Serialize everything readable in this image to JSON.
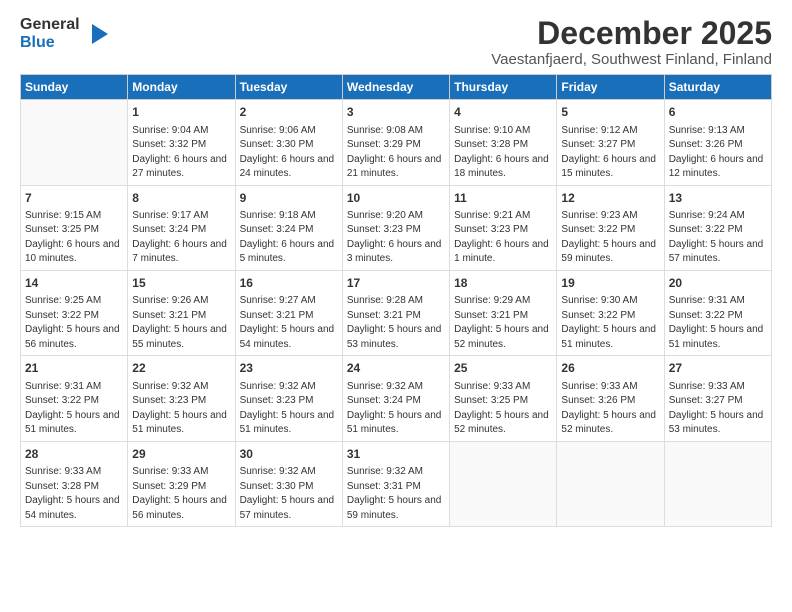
{
  "logo": {
    "line1": "General",
    "line2": "Blue"
  },
  "title": "December 2025",
  "subtitle": "Vaestanfjaerd, Southwest Finland, Finland",
  "days_of_week": [
    "Sunday",
    "Monday",
    "Tuesday",
    "Wednesday",
    "Thursday",
    "Friday",
    "Saturday"
  ],
  "weeks": [
    [
      {
        "day": "",
        "empty": true
      },
      {
        "day": "1",
        "sunrise": "Sunrise: 9:04 AM",
        "sunset": "Sunset: 3:32 PM",
        "daylight": "Daylight: 6 hours and 27 minutes."
      },
      {
        "day": "2",
        "sunrise": "Sunrise: 9:06 AM",
        "sunset": "Sunset: 3:30 PM",
        "daylight": "Daylight: 6 hours and 24 minutes."
      },
      {
        "day": "3",
        "sunrise": "Sunrise: 9:08 AM",
        "sunset": "Sunset: 3:29 PM",
        "daylight": "Daylight: 6 hours and 21 minutes."
      },
      {
        "day": "4",
        "sunrise": "Sunrise: 9:10 AM",
        "sunset": "Sunset: 3:28 PM",
        "daylight": "Daylight: 6 hours and 18 minutes."
      },
      {
        "day": "5",
        "sunrise": "Sunrise: 9:12 AM",
        "sunset": "Sunset: 3:27 PM",
        "daylight": "Daylight: 6 hours and 15 minutes."
      },
      {
        "day": "6",
        "sunrise": "Sunrise: 9:13 AM",
        "sunset": "Sunset: 3:26 PM",
        "daylight": "Daylight: 6 hours and 12 minutes."
      }
    ],
    [
      {
        "day": "7",
        "sunrise": "Sunrise: 9:15 AM",
        "sunset": "Sunset: 3:25 PM",
        "daylight": "Daylight: 6 hours and 10 minutes."
      },
      {
        "day": "8",
        "sunrise": "Sunrise: 9:17 AM",
        "sunset": "Sunset: 3:24 PM",
        "daylight": "Daylight: 6 hours and 7 minutes."
      },
      {
        "day": "9",
        "sunrise": "Sunrise: 9:18 AM",
        "sunset": "Sunset: 3:24 PM",
        "daylight": "Daylight: 6 hours and 5 minutes."
      },
      {
        "day": "10",
        "sunrise": "Sunrise: 9:20 AM",
        "sunset": "Sunset: 3:23 PM",
        "daylight": "Daylight: 6 hours and 3 minutes."
      },
      {
        "day": "11",
        "sunrise": "Sunrise: 9:21 AM",
        "sunset": "Sunset: 3:23 PM",
        "daylight": "Daylight: 6 hours and 1 minute."
      },
      {
        "day": "12",
        "sunrise": "Sunrise: 9:23 AM",
        "sunset": "Sunset: 3:22 PM",
        "daylight": "Daylight: 5 hours and 59 minutes."
      },
      {
        "day": "13",
        "sunrise": "Sunrise: 9:24 AM",
        "sunset": "Sunset: 3:22 PM",
        "daylight": "Daylight: 5 hours and 57 minutes."
      }
    ],
    [
      {
        "day": "14",
        "sunrise": "Sunrise: 9:25 AM",
        "sunset": "Sunset: 3:22 PM",
        "daylight": "Daylight: 5 hours and 56 minutes."
      },
      {
        "day": "15",
        "sunrise": "Sunrise: 9:26 AM",
        "sunset": "Sunset: 3:21 PM",
        "daylight": "Daylight: 5 hours and 55 minutes."
      },
      {
        "day": "16",
        "sunrise": "Sunrise: 9:27 AM",
        "sunset": "Sunset: 3:21 PM",
        "daylight": "Daylight: 5 hours and 54 minutes."
      },
      {
        "day": "17",
        "sunrise": "Sunrise: 9:28 AM",
        "sunset": "Sunset: 3:21 PM",
        "daylight": "Daylight: 5 hours and 53 minutes."
      },
      {
        "day": "18",
        "sunrise": "Sunrise: 9:29 AM",
        "sunset": "Sunset: 3:21 PM",
        "daylight": "Daylight: 5 hours and 52 minutes."
      },
      {
        "day": "19",
        "sunrise": "Sunrise: 9:30 AM",
        "sunset": "Sunset: 3:22 PM",
        "daylight": "Daylight: 5 hours and 51 minutes."
      },
      {
        "day": "20",
        "sunrise": "Sunrise: 9:31 AM",
        "sunset": "Sunset: 3:22 PM",
        "daylight": "Daylight: 5 hours and 51 minutes."
      }
    ],
    [
      {
        "day": "21",
        "sunrise": "Sunrise: 9:31 AM",
        "sunset": "Sunset: 3:22 PM",
        "daylight": "Daylight: 5 hours and 51 minutes."
      },
      {
        "day": "22",
        "sunrise": "Sunrise: 9:32 AM",
        "sunset": "Sunset: 3:23 PM",
        "daylight": "Daylight: 5 hours and 51 minutes."
      },
      {
        "day": "23",
        "sunrise": "Sunrise: 9:32 AM",
        "sunset": "Sunset: 3:23 PM",
        "daylight": "Daylight: 5 hours and 51 minutes."
      },
      {
        "day": "24",
        "sunrise": "Sunrise: 9:32 AM",
        "sunset": "Sunset: 3:24 PM",
        "daylight": "Daylight: 5 hours and 51 minutes."
      },
      {
        "day": "25",
        "sunrise": "Sunrise: 9:33 AM",
        "sunset": "Sunset: 3:25 PM",
        "daylight": "Daylight: 5 hours and 52 minutes."
      },
      {
        "day": "26",
        "sunrise": "Sunrise: 9:33 AM",
        "sunset": "Sunset: 3:26 PM",
        "daylight": "Daylight: 5 hours and 52 minutes."
      },
      {
        "day": "27",
        "sunrise": "Sunrise: 9:33 AM",
        "sunset": "Sunset: 3:27 PM",
        "daylight": "Daylight: 5 hours and 53 minutes."
      }
    ],
    [
      {
        "day": "28",
        "sunrise": "Sunrise: 9:33 AM",
        "sunset": "Sunset: 3:28 PM",
        "daylight": "Daylight: 5 hours and 54 minutes."
      },
      {
        "day": "29",
        "sunrise": "Sunrise: 9:33 AM",
        "sunset": "Sunset: 3:29 PM",
        "daylight": "Daylight: 5 hours and 56 minutes."
      },
      {
        "day": "30",
        "sunrise": "Sunrise: 9:32 AM",
        "sunset": "Sunset: 3:30 PM",
        "daylight": "Daylight: 5 hours and 57 minutes."
      },
      {
        "day": "31",
        "sunrise": "Sunrise: 9:32 AM",
        "sunset": "Sunset: 3:31 PM",
        "daylight": "Daylight: 5 hours and 59 minutes."
      },
      {
        "day": "",
        "empty": true
      },
      {
        "day": "",
        "empty": true
      },
      {
        "day": "",
        "empty": true
      }
    ]
  ]
}
